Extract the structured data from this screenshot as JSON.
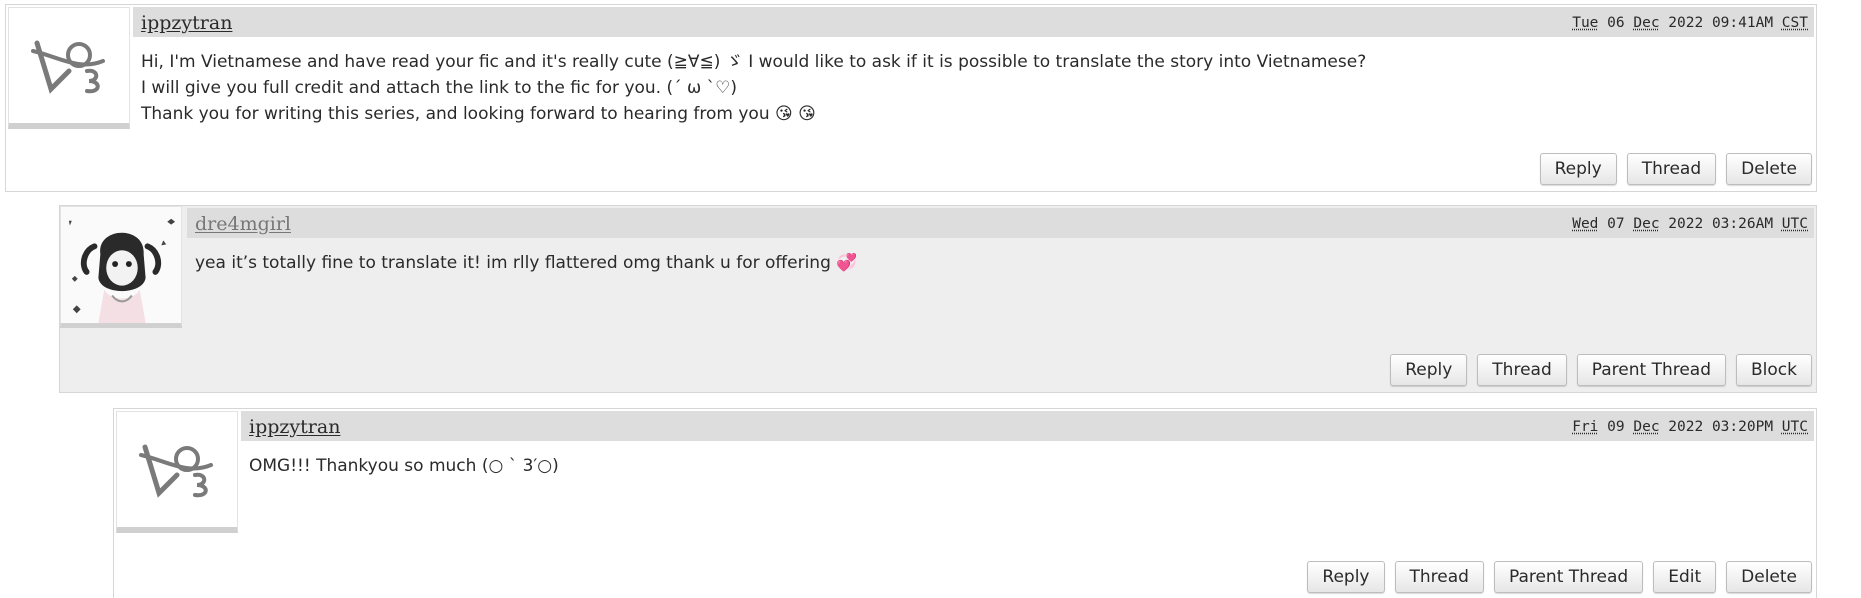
{
  "comments": [
    {
      "username": "ippzytran",
      "date": {
        "weekday": "Tue",
        "day": "06",
        "month": "Dec",
        "year_time": "2022 09:41AM",
        "tz": "CST"
      },
      "lines": [
        "Hi, I'm Vietnamese and have read your fic and it's really cute (≧∀≦) ゞ I would like to ask if it is possible to translate the story into Vietnamese?",
        "I will give you full credit and attach the link to the fic for you. (´ ω `♡)",
        "Thank you for writing this series, and looking forward to hearing from you 😘 😘"
      ],
      "actions": [
        "Reply",
        "Thread",
        "Delete"
      ]
    },
    {
      "username": "dre4mgirl",
      "date": {
        "weekday": "Wed",
        "day": "07",
        "month": "Dec",
        "year_time": "2022 03:26AM",
        "tz": "UTC"
      },
      "lines": [
        "yea it’s totally fine to translate it! im rlly flattered omg thank u for offering 💞"
      ],
      "actions": [
        "Reply",
        "Thread",
        "Parent Thread",
        "Block"
      ]
    },
    {
      "username": "ippzytran",
      "date": {
        "weekday": "Fri",
        "day": "09",
        "month": "Dec",
        "year_time": "2022 03:20PM",
        "tz": "UTC"
      },
      "lines": [
        "OMG!!! Thankyou so much (○ ` 3′○)"
      ],
      "actions": [
        "Reply",
        "Thread",
        "Parent Thread",
        "Edit",
        "Delete"
      ]
    }
  ]
}
